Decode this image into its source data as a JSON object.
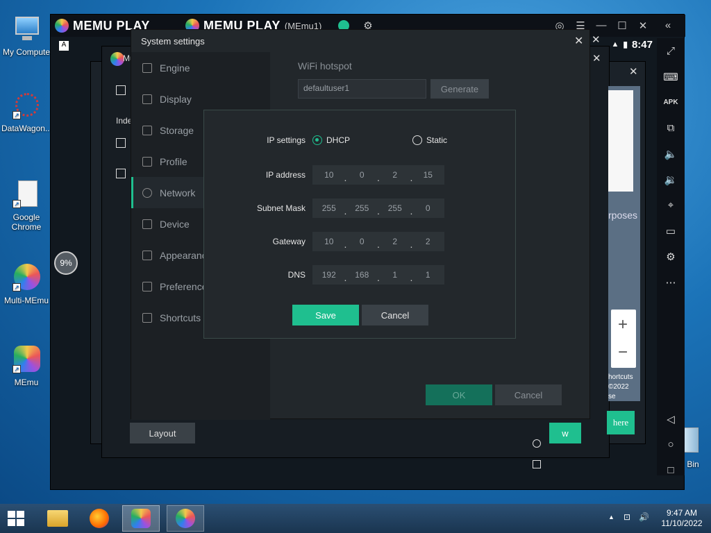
{
  "desktop": {
    "icons": [
      {
        "label": "My Compute"
      },
      {
        "label": "DataWagon..."
      },
      {
        "label": "Google Chrome"
      },
      {
        "label": "Multi-MEmu"
      },
      {
        "label": "MEmu"
      },
      {
        "label": "Bin"
      }
    ]
  },
  "emulator": {
    "brand": "MEMU PLAY",
    "instance": "(MEmu1)",
    "clock": "8:47",
    "progress_badge": "9%",
    "bg_window_title": "Mu",
    "bg_partial_text": "Inde",
    "bg_layout_button": "Layout",
    "bg_purposes_text": "rposes",
    "bg_shortcuts_text": "hortcuts",
    "bg_year_text": "©2022",
    "bg_se_text": "se",
    "bg_here_button": "here",
    "bg_w_button": "w",
    "map_plus": "+",
    "map_minus": "−"
  },
  "settings": {
    "title": "System settings",
    "nav": [
      {
        "label": "Engine"
      },
      {
        "label": "Display"
      },
      {
        "label": "Storage"
      },
      {
        "label": "Profile"
      },
      {
        "label": "Network"
      },
      {
        "label": "Device"
      },
      {
        "label": "Appearanc"
      },
      {
        "label": "Preference"
      },
      {
        "label": "Shortcuts"
      }
    ],
    "wifi_label": "WiFi hotspot",
    "wifi_value": "defaultuser1",
    "generate_button": "Generate",
    "ok_button": "OK",
    "cancel_button": "Cancel"
  },
  "network_modal": {
    "ip_settings_label": "IP settings",
    "dhcp_label": "DHCP",
    "static_label": "Static",
    "selected_mode": "DHCP",
    "ip_address_label": "IP address",
    "ip_address": [
      "10",
      "0",
      "2",
      "15"
    ],
    "subnet_label": "Subnet Mask",
    "subnet": [
      "255",
      "255",
      "255",
      "0"
    ],
    "gateway_label": "Gateway",
    "gateway": [
      "10",
      "0",
      "2",
      "2"
    ],
    "dns_label": "DNS",
    "dns": [
      "192",
      "168",
      "1",
      "1"
    ],
    "save_button": "Save",
    "cancel_button": "Cancel"
  },
  "taskbar": {
    "time": "9:47 AM",
    "date": "11/10/2022"
  },
  "colors": {
    "accent": "#1fbf8f",
    "dialog_bg": "#22272b",
    "modal_border": "#3a4a48"
  }
}
